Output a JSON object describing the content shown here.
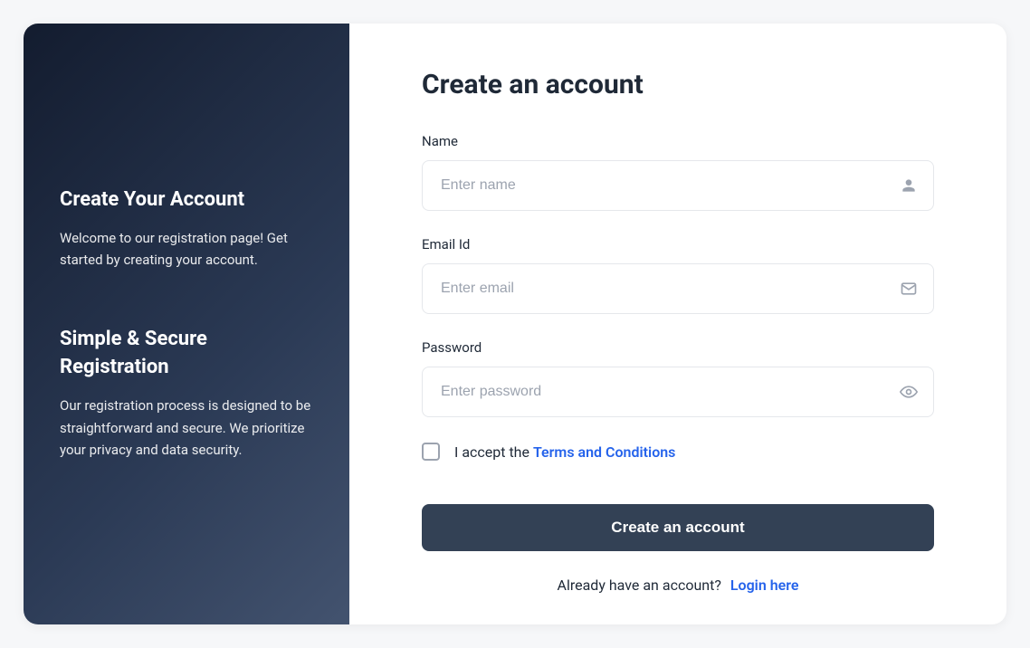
{
  "sidebar": {
    "block1": {
      "title": "Create Your Account",
      "text": "Welcome to our registration page! Get started by creating your account."
    },
    "block2": {
      "title": "Simple & Secure Registration",
      "text": "Our registration process is designed to be straightforward and secure. We prioritize your privacy and data security."
    }
  },
  "form": {
    "title": "Create an account",
    "name": {
      "label": "Name",
      "placeholder": "Enter name",
      "value": ""
    },
    "email": {
      "label": "Email Id",
      "placeholder": "Enter email",
      "value": ""
    },
    "password": {
      "label": "Password",
      "placeholder": "Enter password",
      "value": ""
    },
    "terms": {
      "prefix": "I accept the ",
      "link": "Terms and Conditions"
    },
    "submit": "Create an account",
    "footer": {
      "text": "Already have an account? ",
      "link": "Login here"
    }
  }
}
